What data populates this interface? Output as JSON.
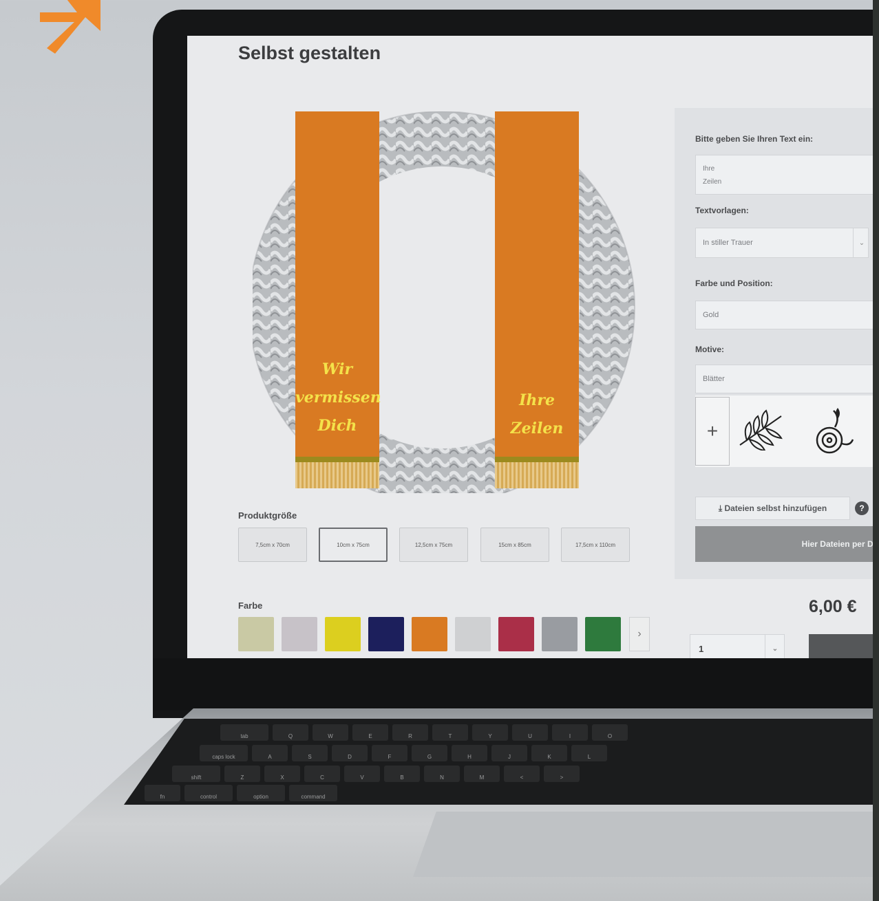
{
  "page": {
    "title": "Selbst gestalten",
    "ribbon_left_lines": [
      "Wir",
      "vermissen",
      "Dich"
    ],
    "ribbon_right_lines": [
      "Ihre",
      "Zeilen"
    ],
    "size_label": "Produktgröße",
    "sizes": [
      "7,5cm x 70cm",
      "10cm x 75cm",
      "12,5cm x 75cm",
      "15cm x 85cm",
      "17,5cm x 110cm"
    ],
    "selected_size_index": 1,
    "color_label": "Farbe",
    "colors": [
      "#c9c9a4",
      "#c7c2c8",
      "#dccf1f",
      "#1c1f5c",
      "#d97a22",
      "#cfd0d2",
      "#aa2f48",
      "#999ca1",
      "#2e7a3d"
    ],
    "selected_color_index": 4,
    "color_next": "›"
  },
  "panel": {
    "text_label": "Bitte geben Sie Ihren Text ein:",
    "text_value_line1": "Ihre",
    "text_value_line2": "Zeilen",
    "templates_label": "Textvorlagen:",
    "templates_value": "In stiller Trauer",
    "color_position_label": "Farbe und Position:",
    "color_position_value": "Gold",
    "motive_label": "Motive:",
    "motive_value": "Blätter",
    "motif_add": "+",
    "upload_label": "⤓ Dateien selbst hinzufügen",
    "help_icon": "?",
    "dropzone_label": "Hier Dateien per Dra"
  },
  "purchase": {
    "price": "6,00 €",
    "quantity": "1"
  },
  "keyboard": {
    "row1": [
      "tab",
      "Q",
      "W",
      "E",
      "R",
      "T",
      "Y",
      "U",
      "I",
      "O"
    ],
    "row2": [
      "caps lock",
      "A",
      "S",
      "D",
      "F",
      "G",
      "H",
      "J",
      "K",
      "L"
    ],
    "row3": [
      "shift",
      "Z",
      "X",
      "C",
      "V",
      "B",
      "N",
      "M",
      "<",
      ">"
    ],
    "row4": [
      "fn",
      "control",
      "option",
      "command"
    ]
  },
  "colors": {
    "accent_orange": "#f08a2a",
    "ribbon": "#d97a22",
    "ribbon_text": "#f4e24a"
  }
}
